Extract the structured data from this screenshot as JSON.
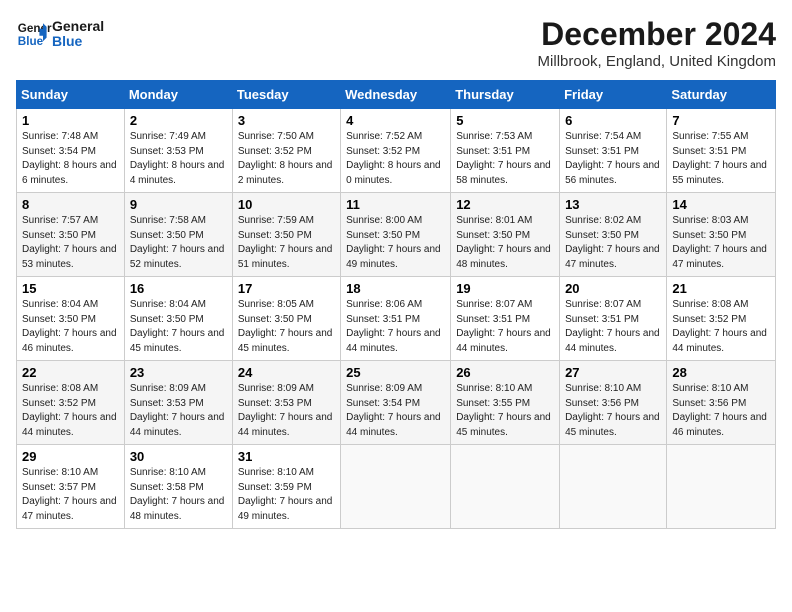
{
  "logo": {
    "line1": "General",
    "line2": "Blue"
  },
  "title": "December 2024",
  "subtitle": "Millbrook, England, United Kingdom",
  "days_of_week": [
    "Sunday",
    "Monday",
    "Tuesday",
    "Wednesday",
    "Thursday",
    "Friday",
    "Saturday"
  ],
  "weeks": [
    [
      {
        "day": "1",
        "sunrise": "7:48 AM",
        "sunset": "3:54 PM",
        "daylight": "8 hours and 6 minutes."
      },
      {
        "day": "2",
        "sunrise": "7:49 AM",
        "sunset": "3:53 PM",
        "daylight": "8 hours and 4 minutes."
      },
      {
        "day": "3",
        "sunrise": "7:50 AM",
        "sunset": "3:52 PM",
        "daylight": "8 hours and 2 minutes."
      },
      {
        "day": "4",
        "sunrise": "7:52 AM",
        "sunset": "3:52 PM",
        "daylight": "8 hours and 0 minutes."
      },
      {
        "day": "5",
        "sunrise": "7:53 AM",
        "sunset": "3:51 PM",
        "daylight": "7 hours and 58 minutes."
      },
      {
        "day": "6",
        "sunrise": "7:54 AM",
        "sunset": "3:51 PM",
        "daylight": "7 hours and 56 minutes."
      },
      {
        "day": "7",
        "sunrise": "7:55 AM",
        "sunset": "3:51 PM",
        "daylight": "7 hours and 55 minutes."
      }
    ],
    [
      {
        "day": "8",
        "sunrise": "7:57 AM",
        "sunset": "3:50 PM",
        "daylight": "7 hours and 53 minutes."
      },
      {
        "day": "9",
        "sunrise": "7:58 AM",
        "sunset": "3:50 PM",
        "daylight": "7 hours and 52 minutes."
      },
      {
        "day": "10",
        "sunrise": "7:59 AM",
        "sunset": "3:50 PM",
        "daylight": "7 hours and 51 minutes."
      },
      {
        "day": "11",
        "sunrise": "8:00 AM",
        "sunset": "3:50 PM",
        "daylight": "7 hours and 49 minutes."
      },
      {
        "day": "12",
        "sunrise": "8:01 AM",
        "sunset": "3:50 PM",
        "daylight": "7 hours and 48 minutes."
      },
      {
        "day": "13",
        "sunrise": "8:02 AM",
        "sunset": "3:50 PM",
        "daylight": "7 hours and 47 minutes."
      },
      {
        "day": "14",
        "sunrise": "8:03 AM",
        "sunset": "3:50 PM",
        "daylight": "7 hours and 47 minutes."
      }
    ],
    [
      {
        "day": "15",
        "sunrise": "8:04 AM",
        "sunset": "3:50 PM",
        "daylight": "7 hours and 46 minutes."
      },
      {
        "day": "16",
        "sunrise": "8:04 AM",
        "sunset": "3:50 PM",
        "daylight": "7 hours and 45 minutes."
      },
      {
        "day": "17",
        "sunrise": "8:05 AM",
        "sunset": "3:50 PM",
        "daylight": "7 hours and 45 minutes."
      },
      {
        "day": "18",
        "sunrise": "8:06 AM",
        "sunset": "3:51 PM",
        "daylight": "7 hours and 44 minutes."
      },
      {
        "day": "19",
        "sunrise": "8:07 AM",
        "sunset": "3:51 PM",
        "daylight": "7 hours and 44 minutes."
      },
      {
        "day": "20",
        "sunrise": "8:07 AM",
        "sunset": "3:51 PM",
        "daylight": "7 hours and 44 minutes."
      },
      {
        "day": "21",
        "sunrise": "8:08 AM",
        "sunset": "3:52 PM",
        "daylight": "7 hours and 44 minutes."
      }
    ],
    [
      {
        "day": "22",
        "sunrise": "8:08 AM",
        "sunset": "3:52 PM",
        "daylight": "7 hours and 44 minutes."
      },
      {
        "day": "23",
        "sunrise": "8:09 AM",
        "sunset": "3:53 PM",
        "daylight": "7 hours and 44 minutes."
      },
      {
        "day": "24",
        "sunrise": "8:09 AM",
        "sunset": "3:53 PM",
        "daylight": "7 hours and 44 minutes."
      },
      {
        "day": "25",
        "sunrise": "8:09 AM",
        "sunset": "3:54 PM",
        "daylight": "7 hours and 44 minutes."
      },
      {
        "day": "26",
        "sunrise": "8:10 AM",
        "sunset": "3:55 PM",
        "daylight": "7 hours and 45 minutes."
      },
      {
        "day": "27",
        "sunrise": "8:10 AM",
        "sunset": "3:56 PM",
        "daylight": "7 hours and 45 minutes."
      },
      {
        "day": "28",
        "sunrise": "8:10 AM",
        "sunset": "3:56 PM",
        "daylight": "7 hours and 46 minutes."
      }
    ],
    [
      {
        "day": "29",
        "sunrise": "8:10 AM",
        "sunset": "3:57 PM",
        "daylight": "7 hours and 47 minutes."
      },
      {
        "day": "30",
        "sunrise": "8:10 AM",
        "sunset": "3:58 PM",
        "daylight": "7 hours and 48 minutes."
      },
      {
        "day": "31",
        "sunrise": "8:10 AM",
        "sunset": "3:59 PM",
        "daylight": "7 hours and 49 minutes."
      },
      null,
      null,
      null,
      null
    ]
  ]
}
